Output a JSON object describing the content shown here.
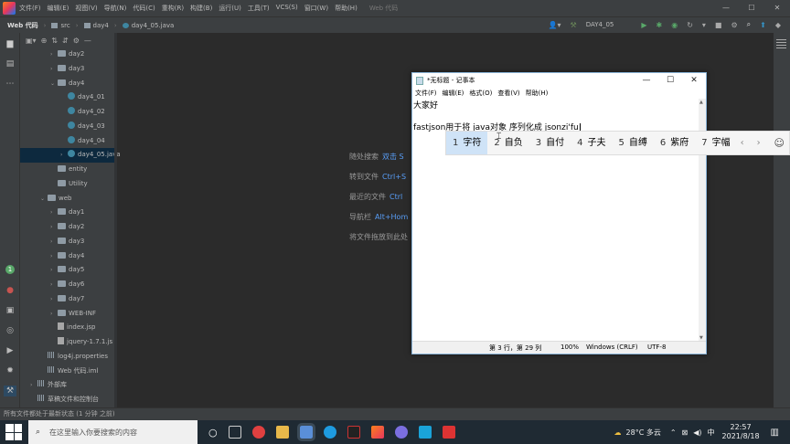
{
  "menubar": {
    "items": [
      "文件(F)",
      "编辑(E)",
      "视图(V)",
      "导航(N)",
      "代码(C)",
      "重构(R)",
      "构建(B)",
      "运行(U)",
      "工具(T)",
      "VCS(S)",
      "窗口(W)",
      "帮助(H)"
    ],
    "title": "Web 代码"
  },
  "breadcrumb": {
    "project": "Web 代码",
    "parts": [
      "src",
      "day4",
      "day4_05.java"
    ]
  },
  "runconfig": "DAY4_05",
  "tree": [
    {
      "label": "day2",
      "type": "folder",
      "indent": 1,
      "arrow": "›"
    },
    {
      "label": "day3",
      "type": "folder",
      "indent": 1,
      "arrow": "›"
    },
    {
      "label": "day4",
      "type": "folder",
      "indent": 1,
      "arrow": "⌄"
    },
    {
      "label": "day4_01",
      "type": "class",
      "indent": 2,
      "arrow": ""
    },
    {
      "label": "day4_02",
      "type": "class",
      "indent": 2,
      "arrow": ""
    },
    {
      "label": "day4_03",
      "type": "class",
      "indent": 2,
      "arrow": ""
    },
    {
      "label": "day4_04",
      "type": "class",
      "indent": 2,
      "arrow": ""
    },
    {
      "label": "day4_05.java",
      "type": "class",
      "indent": 2,
      "arrow": "›",
      "selected": true
    },
    {
      "label": "entity",
      "type": "folder",
      "indent": 1,
      "arrow": ""
    },
    {
      "label": "Utility",
      "type": "folder",
      "indent": 1,
      "arrow": ""
    },
    {
      "label": "web",
      "type": "folder",
      "indent": 0,
      "arrow": "⌄"
    },
    {
      "label": "day1",
      "type": "folder",
      "indent": 1,
      "arrow": "›"
    },
    {
      "label": "day2",
      "type": "folder",
      "indent": 1,
      "arrow": "›"
    },
    {
      "label": "day3",
      "type": "folder",
      "indent": 1,
      "arrow": "›"
    },
    {
      "label": "day4",
      "type": "folder",
      "indent": 1,
      "arrow": "›"
    },
    {
      "label": "day5",
      "type": "folder",
      "indent": 1,
      "arrow": "›"
    },
    {
      "label": "day6",
      "type": "folder",
      "indent": 1,
      "arrow": "›"
    },
    {
      "label": "day7",
      "type": "folder",
      "indent": 1,
      "arrow": "›"
    },
    {
      "label": "WEB-INF",
      "type": "folder",
      "indent": 1,
      "arrow": "›"
    },
    {
      "label": "index.jsp",
      "type": "file",
      "indent": 1,
      "arrow": ""
    },
    {
      "label": "jquery-1.7.1.js",
      "type": "file",
      "indent": 1,
      "arrow": ""
    },
    {
      "label": "log4j.properties",
      "type": "bars",
      "indent": 0,
      "arrow": ""
    },
    {
      "label": "Web 代码.iml",
      "type": "bars",
      "indent": 0,
      "arrow": ""
    },
    {
      "label": "外部库",
      "type": "bars",
      "indent": -1,
      "arrow": "›"
    },
    {
      "label": "草稿文件和控制台",
      "type": "bars",
      "indent": -1,
      "arrow": ""
    }
  ],
  "hints": [
    {
      "key": "随处搜索",
      "value": "双击 S"
    },
    {
      "key": "转到文件",
      "value": "Ctrl+S"
    },
    {
      "key": "最近的文件",
      "value": "Ctrl"
    },
    {
      "key": "导航栏",
      "value": "Alt+Hom"
    },
    {
      "key": "将文件拖放到此处",
      "value": ""
    }
  ],
  "status": "所有文件都处于最新状态 (1 分钟 之前)",
  "notepad": {
    "title": "*无标题 - 记事本",
    "menu": [
      "文件(F)",
      "编辑(E)",
      "格式(O)",
      "查看(V)",
      "帮助(H)"
    ],
    "lines": [
      "大家好",
      "",
      "fastjson用于将 java对象 序列化成 jsonzi'fu"
    ],
    "status": {
      "pos": "第 3 行，第 29 列",
      "zoom": "100%",
      "eol": "Windows (CRLF)",
      "enc": "UTF-8"
    }
  },
  "ime": {
    "candidates": [
      {
        "n": "1",
        "t": "字符"
      },
      {
        "n": "2",
        "t": "自负"
      },
      {
        "n": "3",
        "t": "自付"
      },
      {
        "n": "4",
        "t": "子夫"
      },
      {
        "n": "5",
        "t": "自缚"
      },
      {
        "n": "6",
        "t": "紫府"
      },
      {
        "n": "7",
        "t": "字幅"
      }
    ]
  },
  "taskbar": {
    "search_placeholder": "在这里输入你要搜索的内容",
    "weather": "28°C 多云",
    "ime_mode": "中",
    "time": "22:57",
    "date": "2021/8/18"
  },
  "colors": {
    "ide_bg": "#2b2b2b",
    "panel": "#3c3f41",
    "accent": "#589df6",
    "ime_highlight": "#cfe3f7"
  }
}
